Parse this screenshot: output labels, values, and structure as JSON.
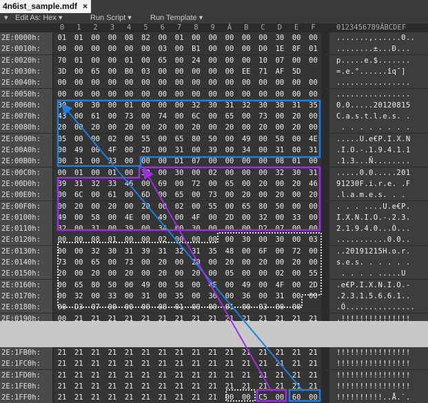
{
  "tab": {
    "title": "4n6ist_sample.mdf",
    "close": "×"
  },
  "toolbar": {
    "menu_icon": "≡",
    "edit_as": "Edit As: Hex",
    "run_script": "Run Script",
    "run_template": "Run Template",
    "dropdown": "▾"
  },
  "col_headers": [
    "0",
    "1",
    "2",
    "3",
    "4",
    "5",
    "6",
    "7",
    "8",
    "9",
    "Ă",
    "B",
    "C",
    "D",
    "E",
    "F"
  ],
  "ascii_header": "0123456789ĂBCDEF",
  "rows_top": [
    {
      "addr": "2E:0000h:",
      "bytes": [
        "01",
        "01",
        "00",
        "00",
        "08",
        "82",
        "00",
        "01",
        "00",
        "00",
        "00",
        "00",
        "00",
        "30",
        "00",
        "00"
      ],
      "ascii": ".......,......0.."
    },
    {
      "addr": "2E:0010h:",
      "bytes": [
        "00",
        "00",
        "00",
        "00",
        "00",
        "00",
        "03",
        "00",
        "B1",
        "00",
        "00",
        "00",
        "D0",
        "1E",
        "8F",
        "01"
      ],
      "ascii": "........±...Ð..."
    },
    {
      "addr": "2E:0020h:",
      "bytes": [
        "70",
        "01",
        "00",
        "00",
        "01",
        "00",
        "65",
        "00",
        "24",
        "00",
        "00",
        "00",
        "10",
        "07",
        "00",
        "00"
      ],
      "ascii": "p.....e.$......."
    },
    {
      "addr": "2E:0030h:",
      "bytes": [
        "3D",
        "00",
        "65",
        "00",
        "B0",
        "03",
        "00",
        "00",
        "00",
        "00",
        "00",
        "EE",
        "71",
        "AF",
        "5D",
        ""
      ],
      "ascii": "=.e.°......îq¯]"
    },
    {
      "addr": "2E:0040h:",
      "bytes": [
        "00",
        "00",
        "00",
        "00",
        "00",
        "00",
        "00",
        "00",
        "00",
        "00",
        "00",
        "00",
        "00",
        "00",
        "00",
        "00"
      ],
      "ascii": "................"
    },
    {
      "addr": "2E:0050h:",
      "bytes": [
        "00",
        "00",
        "00",
        "00",
        "00",
        "00",
        "00",
        "00",
        "00",
        "00",
        "00",
        "00",
        "00",
        "00",
        "00",
        "00"
      ],
      "ascii": "................"
    },
    {
      "addr": "2E:0060h:",
      "bytes": [
        "30",
        "00",
        "30",
        "00",
        "01",
        "00",
        "00",
        "00",
        "32",
        "30",
        "31",
        "32",
        "30",
        "38",
        "31",
        "35"
      ],
      "ascii": "0.0.....20120815"
    },
    {
      "addr": "2E:0070h:",
      "bytes": [
        "43",
        "00",
        "61",
        "00",
        "73",
        "00",
        "74",
        "00",
        "6C",
        "00",
        "65",
        "00",
        "73",
        "00",
        "20",
        "00"
      ],
      "ascii": "C.a.s.t.l.e.s. ."
    },
    {
      "addr": "2E:0080h:",
      "bytes": [
        "20",
        "00",
        "20",
        "00",
        "20",
        "00",
        "20",
        "00",
        "20",
        "00",
        "20",
        "00",
        "20",
        "00",
        "20",
        "00"
      ],
      "ascii": " . . . . . . . ."
    },
    {
      "addr": "2E:0090h:",
      "bytes": [
        "05",
        "00",
        "00",
        "02",
        "00",
        "55",
        "00",
        "65",
        "80",
        "50",
        "00",
        "49",
        "00",
        "58",
        "00",
        "4E"
      ],
      "ascii": ".....U.e€P.I.X.N"
    },
    {
      "addr": "2E:00A0h:",
      "bytes": [
        "00",
        "49",
        "00",
        "4F",
        "00",
        "2D",
        "00",
        "31",
        "00",
        "39",
        "00",
        "34",
        "00",
        "31",
        "00",
        "31"
      ],
      "ascii": ".I.O.-.1.9.4.1.1"
    },
    {
      "addr": "2E:00B0h:",
      "bytes": [
        "00",
        "31",
        "00",
        "33",
        "00",
        "00",
        "00",
        "D1",
        "07",
        "00",
        "00",
        "00",
        "00",
        "08",
        "01",
        "00"
      ],
      "ascii": ".1.3...Ñ........"
    },
    {
      "addr": "2E:00C0h:",
      "bytes": [
        "00",
        "01",
        "00",
        "01",
        "00",
        "30",
        "00",
        "30",
        "00",
        "02",
        "00",
        "00",
        "00",
        "32",
        "30",
        "31"
      ],
      "ascii": ".....0.0.....201"
    },
    {
      "addr": "2E:00D0h:",
      "bytes": [
        "39",
        "31",
        "32",
        "33",
        "46",
        "00",
        "69",
        "00",
        "72",
        "00",
        "65",
        "00",
        "20",
        "00",
        "20",
        "46"
      ],
      "ascii": "91230F.i.r.e. .F"
    },
    {
      "addr": "2E:00E0h:",
      "bytes": [
        "00",
        "6C",
        "00",
        "61",
        "00",
        "6D",
        "00",
        "65",
        "00",
        "73",
        "00",
        "20",
        "00",
        "20",
        "00",
        "20"
      ],
      "ascii": ".l.a.m.e.s. . . "
    },
    {
      "addr": "2E:00F0h:",
      "bytes": [
        "00",
        "20",
        "00",
        "20",
        "00",
        "20",
        "00",
        "02",
        "00",
        "55",
        "00",
        "65",
        "80",
        "50",
        "00",
        "00"
      ],
      "ascii": ". . . ....U.e€P."
    },
    {
      "addr": "2E:0100h:",
      "bytes": [
        "49",
        "00",
        "58",
        "00",
        "4E",
        "00",
        "49",
        "00",
        "4F",
        "00",
        "2D",
        "00",
        "32",
        "00",
        "33",
        "00"
      ],
      "ascii": "I.X.N.I.O.-.2.3."
    },
    {
      "addr": "2E:0110h:",
      "bytes": [
        "32",
        "00",
        "31",
        "00",
        "39",
        "00",
        "34",
        "00",
        "30",
        "00",
        "00",
        "00",
        "D2",
        "07",
        "00",
        "00"
      ],
      "ascii": "2.1.9.4.0...Ò..."
    },
    {
      "addr": "2E:0120h:",
      "bytes": [
        "00",
        "00",
        "08",
        "01",
        "00",
        "00",
        "02",
        "00",
        "00",
        "00",
        "00",
        "30",
        "00",
        "30",
        "00",
        "03"
      ],
      "ascii": "...........0.0.."
    },
    {
      "addr": "2E:0130h:",
      "bytes": [
        "00",
        "00",
        "32",
        "30",
        "31",
        "39",
        "31",
        "32",
        "31",
        "35",
        "48",
        "00",
        "6F",
        "00",
        "72",
        "00"
      ],
      "ascii": "..20191215H.o.r."
    },
    {
      "addr": "2E:0140h:",
      "bytes": [
        "73",
        "00",
        "65",
        "00",
        "73",
        "00",
        "20",
        "00",
        "20",
        "00",
        "20",
        "00",
        "20",
        "00",
        "20",
        "00"
      ],
      "ascii": "s.e.s. . . . . ."
    },
    {
      "addr": "2E:0150h:",
      "bytes": [
        "20",
        "00",
        "20",
        "00",
        "20",
        "00",
        "20",
        "00",
        "20",
        "00",
        "05",
        "00",
        "00",
        "02",
        "00",
        "55"
      ],
      "ascii": " . . . . .....U"
    },
    {
      "addr": "2E:0160h:",
      "bytes": [
        "00",
        "65",
        "80",
        "50",
        "00",
        "49",
        "00",
        "58",
        "00",
        "4E",
        "00",
        "49",
        "00",
        "4F",
        "00",
        "2D"
      ],
      "ascii": ".e€P.I.X.N.I.O.-"
    },
    {
      "addr": "2E:0170h:",
      "bytes": [
        "00",
        "32",
        "00",
        "33",
        "00",
        "31",
        "00",
        "35",
        "00",
        "36",
        "00",
        "36",
        "00",
        "31",
        "00",
        "00"
      ],
      "ascii": ".2.3.1.5.6.6.1.."
    },
    {
      "addr": "2E:0180h:",
      "bytes": [
        "00",
        "D3",
        "07",
        "00",
        "00",
        "00",
        "08",
        "01",
        "00",
        "00",
        "01",
        "00",
        "03",
        "00",
        "00",
        ""
      ],
      "ascii": ".Ó..............."
    },
    {
      "addr": "2E:0190h:",
      "bytes": [
        "00",
        "21",
        "21",
        "21",
        "21",
        "21",
        "21",
        "21",
        "21",
        "21",
        "21",
        "21",
        "21",
        "21",
        "21",
        "21"
      ],
      "ascii": ".!!!!!!!!!!!!!!!"
    }
  ],
  "rows_bottom": [
    {
      "addr": "2E:1FB0h:",
      "bytes": [
        "21",
        "21",
        "21",
        "21",
        "21",
        "21",
        "21",
        "21",
        "21",
        "21",
        "21",
        "21",
        "21",
        "21",
        "21",
        "21"
      ],
      "ascii": "!!!!!!!!!!!!!!!!"
    },
    {
      "addr": "2E:1FC0h:",
      "bytes": [
        "21",
        "21",
        "21",
        "21",
        "21",
        "21",
        "21",
        "21",
        "21",
        "21",
        "21",
        "21",
        "21",
        "21",
        "21",
        "21"
      ],
      "ascii": "!!!!!!!!!!!!!!!!"
    },
    {
      "addr": "2E:1FD0h:",
      "bytes": [
        "21",
        "21",
        "21",
        "21",
        "21",
        "21",
        "21",
        "21",
        "21",
        "21",
        "21",
        "21",
        "21",
        "21",
        "21",
        "21"
      ],
      "ascii": "!!!!!!!!!!!!!!!!"
    },
    {
      "addr": "2E:1FE0h:",
      "bytes": [
        "21",
        "21",
        "21",
        "21",
        "21",
        "21",
        "21",
        "21",
        "21",
        "21",
        "21",
        "21",
        "21",
        "21",
        "21",
        "21"
      ],
      "ascii": "!!!!!!!!!!!!!!!!"
    },
    {
      "addr": "2E:1FF0h:",
      "bytes": [
        "21",
        "21",
        "21",
        "21",
        "21",
        "21",
        "21",
        "21",
        "21",
        "21",
        "00",
        "00",
        "C5",
        "00",
        "60",
        "00"
      ],
      "ascii": "!!!!!!!!!!..Å.`."
    }
  ],
  "colors": {
    "blue": "#1e7fe0",
    "purple": "#9b30e8",
    "dotted": "#e0e0e0"
  }
}
